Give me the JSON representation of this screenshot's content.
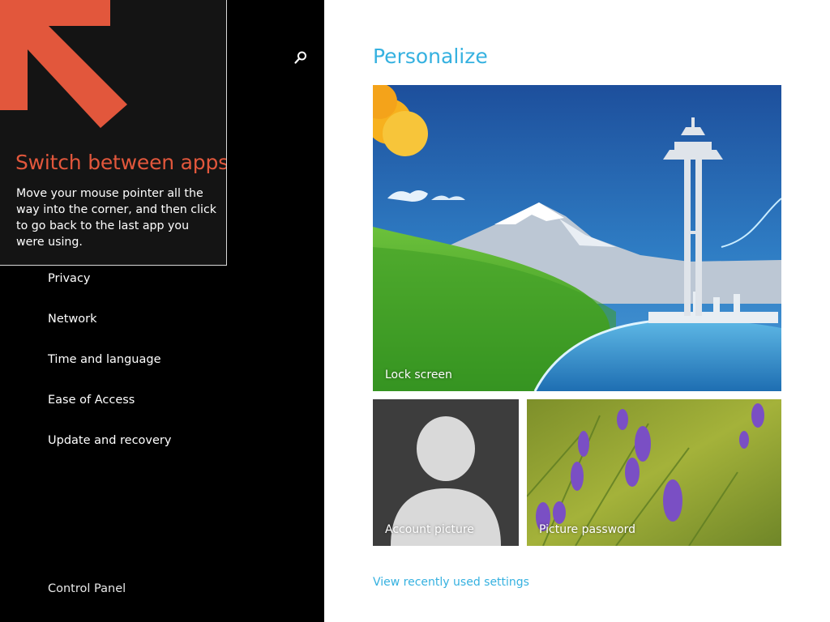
{
  "tip": {
    "title": "Switch between apps",
    "body": "Move your mouse pointer all the way into the corner, and then click to go back to the last app you were using.",
    "arrow_color": "#e2573c"
  },
  "sidebar": {
    "search_icon": "search-icon",
    "items": [
      {
        "label": "Privacy"
      },
      {
        "label": "Network"
      },
      {
        "label": "Time and language"
      },
      {
        "label": "Ease of Access"
      },
      {
        "label": "Update and recovery"
      }
    ],
    "control_panel": "Control Panel"
  },
  "main": {
    "heading": "Personalize",
    "tiles": {
      "lock_screen": "Lock screen",
      "account_picture": "Account picture",
      "picture_password": "Picture password"
    },
    "recent_link": "View recently used settings"
  },
  "colors": {
    "accent": "#35b1e0",
    "tip_accent": "#e2573c",
    "panel_bg": "#000000"
  }
}
